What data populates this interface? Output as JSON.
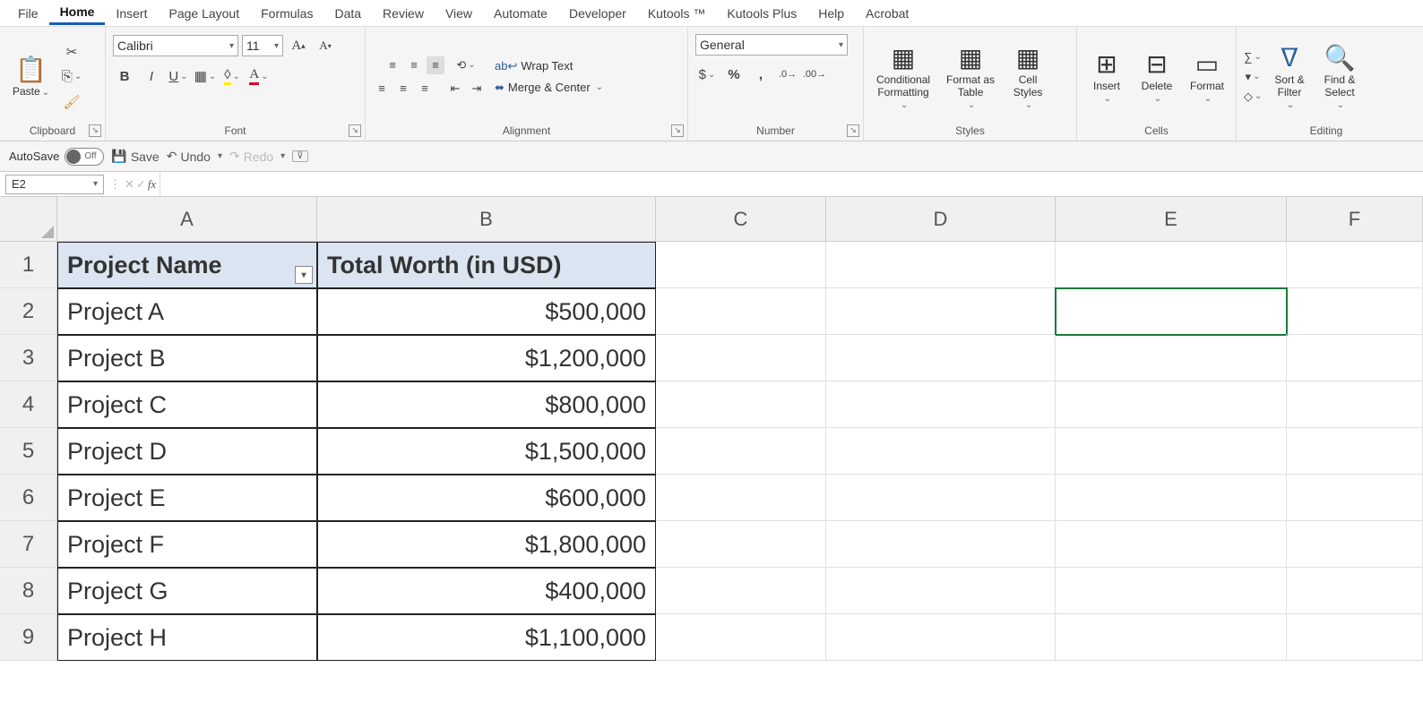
{
  "tabs": [
    "File",
    "Home",
    "Insert",
    "Page Layout",
    "Formulas",
    "Data",
    "Review",
    "View",
    "Automate",
    "Developer",
    "Kutools ™",
    "Kutools Plus",
    "Help",
    "Acrobat"
  ],
  "active_tab": "Home",
  "ribbon": {
    "clipboard": {
      "label": "Clipboard",
      "paste": "Paste"
    },
    "font": {
      "label": "Font",
      "name": "Calibri",
      "size": "11"
    },
    "alignment": {
      "label": "Alignment",
      "wrap": "Wrap Text",
      "merge": "Merge & Center"
    },
    "number": {
      "label": "Number",
      "format": "General"
    },
    "styles": {
      "label": "Styles",
      "conditional1": "Conditional",
      "conditional2": "Formatting",
      "formatas1": "Format as",
      "formatas2": "Table",
      "cell1": "Cell",
      "cell2": "Styles"
    },
    "cells": {
      "label": "Cells",
      "insert": "Insert",
      "delete": "Delete",
      "format": "Format"
    },
    "editing": {
      "label": "Editing",
      "sort1": "Sort &",
      "sort2": "Filter",
      "find1": "Find &",
      "find2": "Select"
    }
  },
  "qat": {
    "autosave": "AutoSave",
    "off": "Off",
    "save": "Save",
    "undo": "Undo",
    "redo": "Redo"
  },
  "formula_bar": {
    "name_box": "E2"
  },
  "columns": [
    "A",
    "B",
    "C",
    "D",
    "E",
    "F"
  ],
  "table": {
    "headers": [
      "Project Name",
      "Total Worth (in USD)"
    ],
    "rows": [
      [
        "Project A",
        "$500,000"
      ],
      [
        "Project B",
        "$1,200,000"
      ],
      [
        "Project C",
        "$800,000"
      ],
      [
        "Project D",
        "$1,500,000"
      ],
      [
        "Project E",
        "$600,000"
      ],
      [
        "Project F",
        "$1,800,000"
      ],
      [
        "Project G",
        "$400,000"
      ],
      [
        "Project H",
        "$1,100,000"
      ]
    ]
  },
  "row_numbers": [
    "1",
    "2",
    "3",
    "4",
    "5",
    "6",
    "7",
    "8",
    "9"
  ]
}
